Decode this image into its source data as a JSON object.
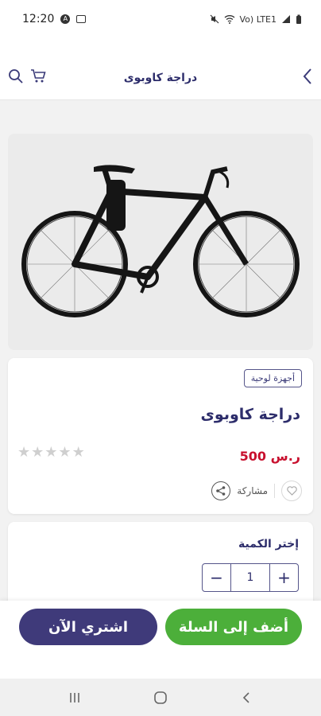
{
  "status_bar": {
    "time": "12:20",
    "right_text": "Vo) LTE1"
  },
  "header": {
    "title": "دراجة كاوبوى"
  },
  "product": {
    "category": "أجهزة لوحية",
    "name": "دراجة كاوبوى",
    "price": "500 ر.س",
    "rating": 0,
    "share_label": "مشاركة"
  },
  "quantity": {
    "label": "إختر الكمية",
    "value": "1",
    "plus": "+",
    "minus": "−"
  },
  "actions": {
    "buy_now": "اشتري الآن",
    "add_to_cart": "أضف إلى السلة"
  },
  "colors": {
    "brand_purple": "#3f3a7a",
    "cart_green": "#4caf3a",
    "price_red": "#c8102e"
  }
}
